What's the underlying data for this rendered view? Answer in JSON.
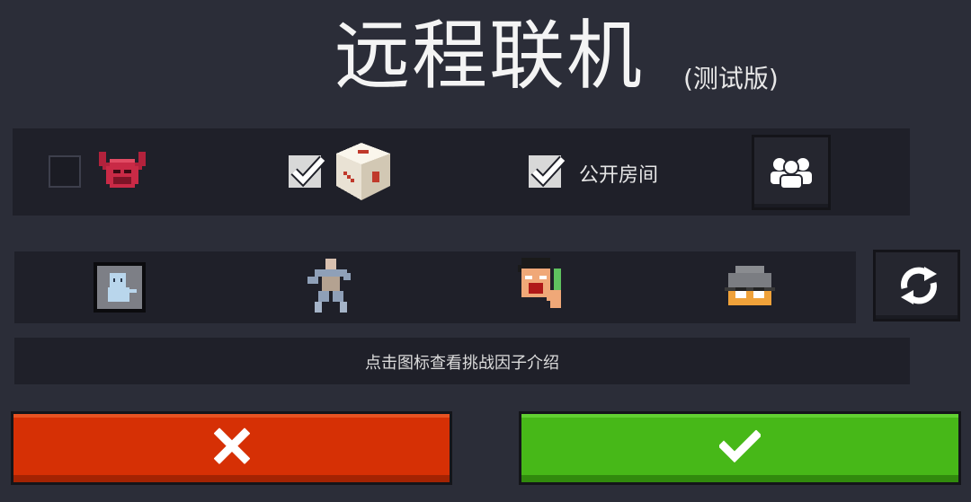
{
  "header": {
    "title": "远程联机",
    "subtitle": "(测试版)"
  },
  "options": {
    "boss_mode": {
      "checked": false,
      "icon": "demon-helmet-icon"
    },
    "random_mode": {
      "checked": true,
      "icon": "dice-icon"
    },
    "public_room": {
      "checked": true,
      "label": "公开房间"
    },
    "players_button": {
      "icon": "group-icon"
    }
  },
  "challenge_factors": {
    "items": [
      {
        "icon": "ghost-portrait-icon"
      },
      {
        "icon": "dancing-skeleton-icon"
      },
      {
        "icon": "screaming-man-knife-icon"
      },
      {
        "icon": "glasses-helmet-icon"
      }
    ],
    "refresh_button": {
      "icon": "refresh-icon"
    }
  },
  "hint": {
    "text": "点击图标查看挑战因子介绍"
  },
  "actions": {
    "cancel": {
      "icon": "x-icon",
      "color": "#d63005"
    },
    "confirm": {
      "icon": "check-icon",
      "color": "#47b818"
    }
  }
}
